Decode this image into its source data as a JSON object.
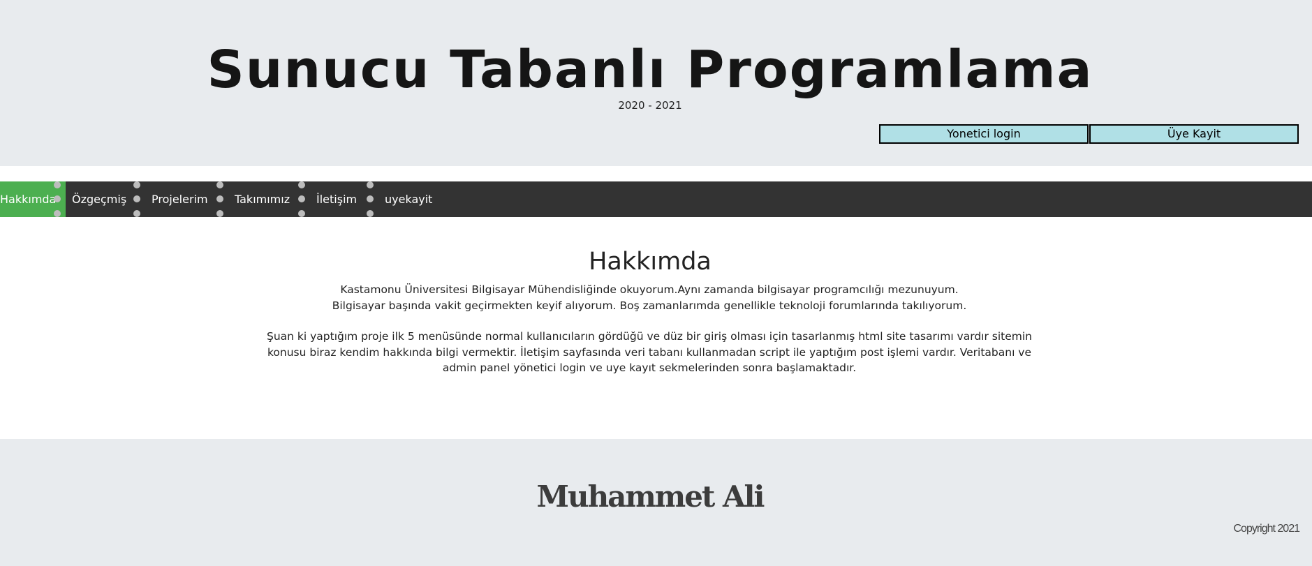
{
  "header": {
    "title": "Sunucu Tabanlı Programlama",
    "years": "2020 - 2021",
    "buttons": {
      "admin_login": "Yonetici login",
      "register": "Üye Kayit"
    }
  },
  "nav": {
    "items": [
      {
        "label": "Hakkımda",
        "active": true
      },
      {
        "label": "Özgeçmiş"
      },
      {
        "label": "Projelerim"
      },
      {
        "label": "Takımımız"
      },
      {
        "label": "İletişim"
      },
      {
        "label": "uyekayit"
      }
    ],
    "colors": {
      "bar": "#333333",
      "active": "#4caf50",
      "separator_dots": "#bdbdbd"
    }
  },
  "main": {
    "heading": "Hakkımda",
    "paragraph1_line1": "Kastamonu Üniversitesi Bilgisayar Mühendisliğinde okuyorum.Aynı zamanda bilgisayar programcılığı mezunuyum.",
    "paragraph1_line2": "Bilgisayar başında vakit geçirmekten keyif alıyorum. Boş zamanlarımda genellikle teknoloji forumlarında takılıyorum.",
    "paragraph2": "Şuan ki yaptığım proje ilk 5 menüsünde normal kullanıcıların gördüğü ve düz bir giriş olması için tasarlanmış html site tasarımı vardır sitemin konusu biraz kendim hakkında bilgi vermektir. İletişim sayfasında veri tabanı kullanmadan script ile yaptığım post işlemi vardır. Veritabanı ve admin panel yönetici login ve uye kayıt sekmelerinden sonra başlamaktadır."
  },
  "footer": {
    "name": "Muhammet Ali",
    "copyright": "Copyright 2021"
  },
  "colors": {
    "header_bg": "#e8ebee",
    "auth_button_bg": "#b0e0e6"
  }
}
